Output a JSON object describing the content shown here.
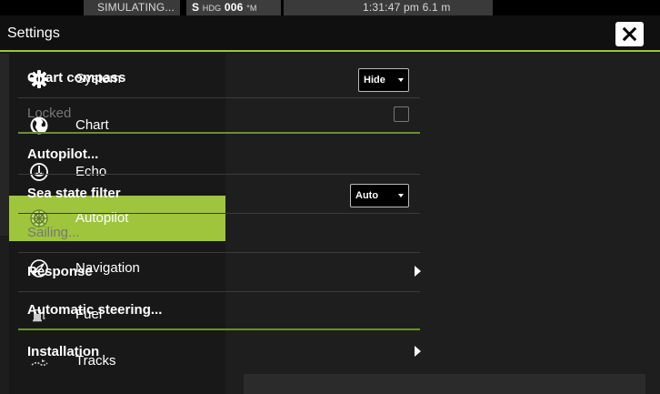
{
  "status_bar": {
    "simulating": "SIMULATING...",
    "hdg_ref": "S",
    "hdg_label": "HDG",
    "hdg_value": "006",
    "hdg_unit": "°M",
    "time_depth": "1:31:47 pm   6.1 m"
  },
  "header": {
    "title": "Settings"
  },
  "sidebar": {
    "items": [
      {
        "label": "System",
        "icon": "gear-icon"
      },
      {
        "label": "Chart",
        "icon": "globe-icon"
      },
      {
        "label": "Echo",
        "icon": "echo-sounder-icon"
      },
      {
        "label": "Autopilot",
        "icon": "helm-wheel-icon",
        "active": true
      },
      {
        "label": "Navigation",
        "icon": "compass-needle-icon"
      },
      {
        "label": "Fuel",
        "icon": "fuel-pump-icon"
      },
      {
        "label": "Tracks",
        "icon": "track-line-icon"
      }
    ]
  },
  "settings": {
    "chart_compass_label": "Chart compass",
    "chart_compass_value": "Hide",
    "locked_label": "Locked",
    "autopilot_label": "Autopilot...",
    "sea_state_label": "Sea state filter",
    "sea_state_value": "Auto",
    "sailing_label": "Sailing...",
    "response_label": "Response",
    "automatic_steering_label": "Automatic steering...",
    "installation_label": "Installation"
  },
  "colors": {
    "accent": "#9ec53c",
    "background": "#1e1e1e",
    "disabled_text": "#777777"
  }
}
